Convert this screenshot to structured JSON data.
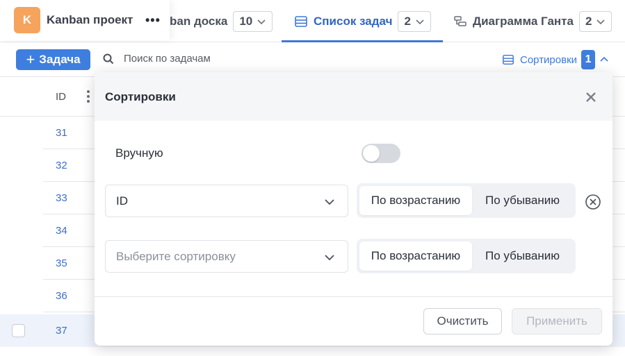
{
  "project": {
    "avatar_letter": "K",
    "name": "Kanban проект",
    "more": "•••"
  },
  "tabs": [
    {
      "label": "ban доска",
      "count": "10"
    },
    {
      "label": "Список задач",
      "count": "2"
    },
    {
      "label": "Диаграмма Ганта",
      "count": "2"
    }
  ],
  "toolbar": {
    "add_label": "Задача",
    "search_placeholder": "Поиск по задачам",
    "sort_label": "Сортировки",
    "sort_count": "1"
  },
  "table": {
    "id_header": "ID",
    "rows": [
      "31",
      "32",
      "33",
      "34",
      "35",
      "36",
      "37"
    ]
  },
  "modal": {
    "title": "Сортировки",
    "manual_label": "Вручную",
    "manual_enabled": false,
    "sort_rules": [
      {
        "field": "ID",
        "ascending_label": "По возрастанию",
        "descending_label": "По убыванию",
        "selected": "ascending"
      },
      {
        "field_placeholder": "Выберите сортировку",
        "ascending_label": "По возрастанию",
        "descending_label": "По убыванию",
        "selected": "ascending"
      }
    ],
    "clear_label": "Очистить",
    "apply_label": "Применить"
  },
  "colors": {
    "accent": "#3e7ede",
    "avatar": "#f6a45d",
    "link": "#3b6fc4"
  }
}
